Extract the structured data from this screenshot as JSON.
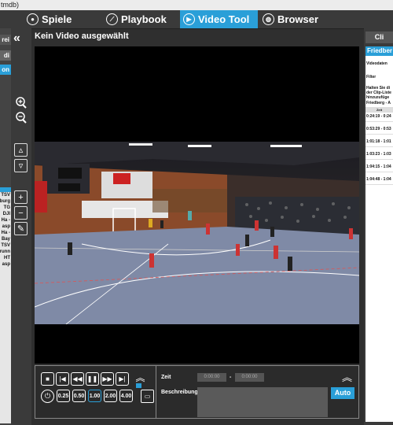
{
  "window": {
    "title": "tmdb)"
  },
  "nav": {
    "tabs": [
      {
        "label": "Spiele",
        "icon": "soccer-ball-icon"
      },
      {
        "label": "Playbook",
        "icon": "playbook-icon"
      },
      {
        "label": "Video Tool",
        "icon": "play-icon",
        "active": true
      },
      {
        "label": "Browser",
        "icon": "globe-icon"
      }
    ]
  },
  "left_panel": {
    "buttons": [
      "rei",
      "di",
      "on"
    ],
    "list": [
      "TSV",
      "burg",
      "TG",
      "DJI",
      "- Ha",
      "asp",
      "- Ha",
      "Bay",
      "TSV",
      "runn",
      "HT",
      "asp"
    ]
  },
  "video": {
    "title": "Kein Video ausgewählt"
  },
  "controls": {
    "speeds": [
      "0.25",
      "0.50",
      "1.00",
      "2.00",
      "4.00"
    ],
    "active_speed": "1.00",
    "time_label": "Zeit",
    "time_from": "0:00:00",
    "time_sep": "-",
    "time_to": "0:00:00",
    "description_label": "Beschreibung",
    "auto_label": "Auto"
  },
  "right_panel": {
    "header": "Cli",
    "subheader": "Friedber",
    "videodaten_label": "Videodaten",
    "filter_label": "Filter",
    "hint": [
      "Halten Sie di",
      "der Clip-Liste",
      "hinzuzufüge"
    ],
    "match": "Friedberg - A",
    "col": "Zeit",
    "clips": [
      "0:24:19 - 0:24",
      "0:53:29 - 0:53",
      "1:01:18 - 1:01",
      "1:03:23 - 1:03",
      "1:04:15 - 1:04",
      "1:04:48 - 1:04"
    ]
  },
  "colors": {
    "accent": "#2a9fd8",
    "court": "#7f8aa6",
    "background": "#2f2f2f"
  }
}
